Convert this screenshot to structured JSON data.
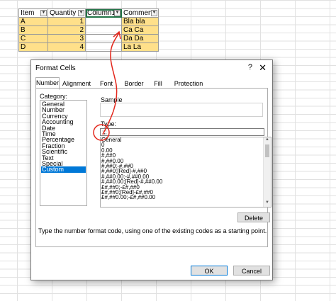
{
  "table": {
    "headers": [
      "Item",
      "Quantity",
      "Column1",
      "Comment"
    ],
    "rows": [
      {
        "item": "A",
        "qty": "1",
        "comment": "Bla bla"
      },
      {
        "item": "B",
        "qty": "2",
        "comment": "Ca Ca"
      },
      {
        "item": "C",
        "qty": "3",
        "comment": "Da Da"
      },
      {
        "item": "D",
        "qty": "4",
        "comment": "La La"
      }
    ]
  },
  "dialog": {
    "title": "Format Cells",
    "help": "?",
    "close": "✕",
    "tabs": [
      "Number",
      "Alignment",
      "Font",
      "Border",
      "Fill",
      "Protection"
    ],
    "category_label": "Category:",
    "categories": [
      "General",
      "Number",
      "Currency",
      "Accounting",
      "Date",
      "Time",
      "Percentage",
      "Fraction",
      "Scientific",
      "Text",
      "Special",
      "Custom"
    ],
    "selected_category": "Custom",
    "sample_label": "Sample",
    "type_label": "Type:",
    "type_value": ";;;",
    "formats": [
      "General",
      "0",
      "0.00",
      "#,##0",
      "#,##0.00",
      "#,##0;-#,##0",
      "#,##0;[Red]-#,##0",
      "#,##0.00;-#,##0.00",
      "#,##0.00;[Red]-#,##0.00",
      "£#,##0;-£#,##0",
      "£#,##0;[Red]-£#,##0",
      "£#,##0.00;-£#,##0.00"
    ],
    "delete_label": "Delete",
    "description": "Type the number format code, using one of the existing codes as a starting point.",
    "ok_label": "OK",
    "cancel_label": "Cancel"
  },
  "colors": {
    "cell_fill": "#ffe08a",
    "selection": "#0078d7",
    "annotation": "#e3261b"
  }
}
